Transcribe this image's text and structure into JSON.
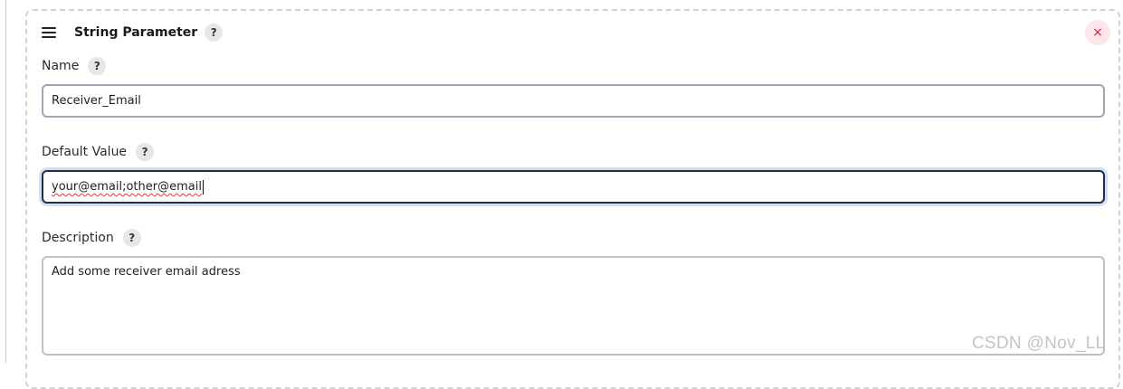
{
  "block": {
    "title": "String Parameter",
    "help": "?",
    "close": "×"
  },
  "fields": {
    "name": {
      "label": "Name",
      "help": "?",
      "value": "Receiver_Email"
    },
    "default_value": {
      "label": "Default Value",
      "help": "?",
      "value": "your@email;other@email"
    },
    "description": {
      "label": "Description",
      "help": "?",
      "value": "Add some receiver email adress"
    }
  },
  "watermark": "CSDN @Nov_LL",
  "colors": {
    "close_bg": "#fde6ea",
    "close_fg": "#d4213d",
    "focus_ring": "#cfe0f2",
    "focus_border": "#1f2f4a"
  }
}
